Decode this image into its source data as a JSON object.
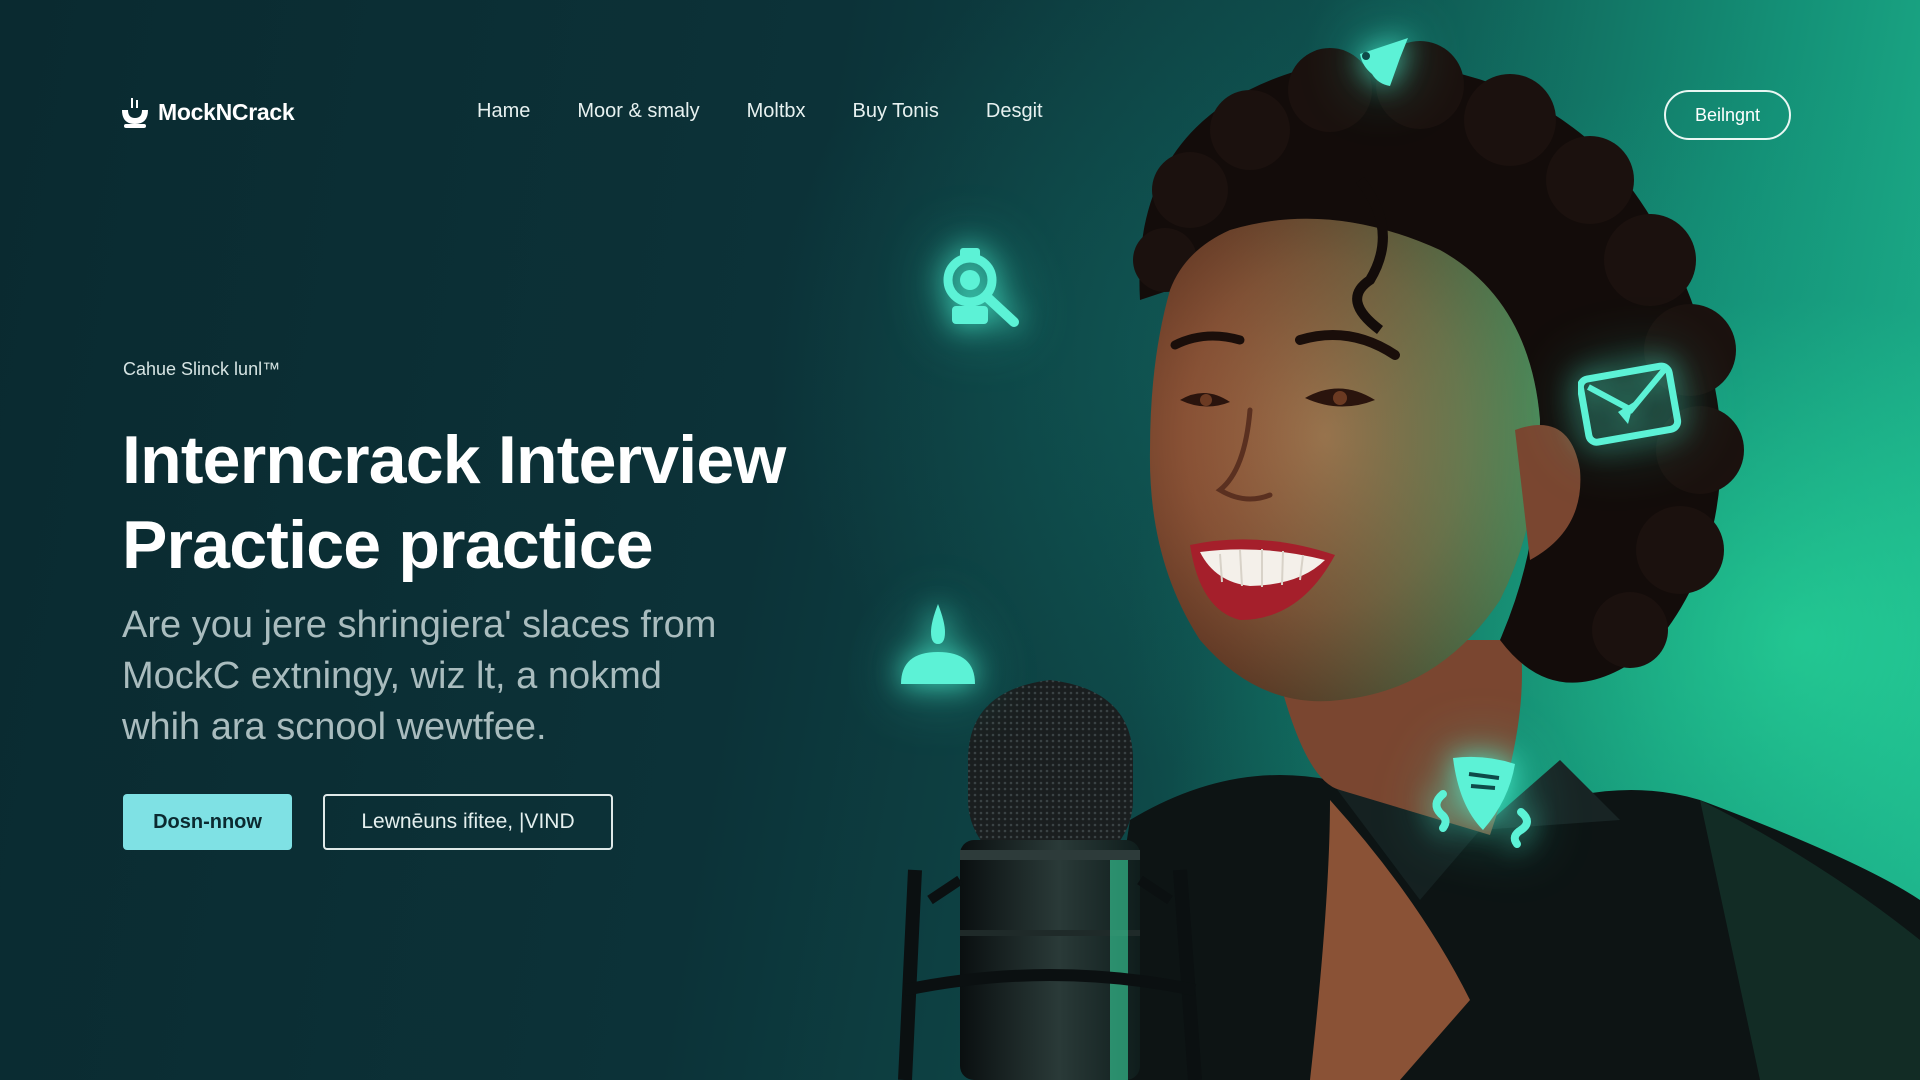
{
  "brand": {
    "name": "MockNCrack"
  },
  "nav": {
    "links": [
      "Hame",
      "Moor & smaly",
      "Moltbx",
      "Buy Tonis",
      "Desgit"
    ],
    "signin_label": "Beilngnt"
  },
  "hero": {
    "eyebrow": "Cahue Slinck lunl™",
    "headline_line1": "Interncrack Interview",
    "headline_line2": "Practice practice",
    "subtitle_line1": "Are you jere shringiera' slaces from",
    "subtitle_line2": "MockC extningy, wiz lt, a nokmd",
    "subtitle_line3": "whih ara scnool wewtfee.",
    "cta_primary": "Dosn-nnow",
    "cta_secondary": "Lewnēuns ifitee, |VIND"
  },
  "icons": {
    "logo": "microphone-logo-icon",
    "floating": [
      "pen-nib-icon",
      "magnifier-camera-icon",
      "envelope-icon",
      "speech-bubble-icon",
      "shield-arrows-icon"
    ]
  },
  "colors": {
    "background_dark": "#0b2a30",
    "accent_teal": "#1fb98f",
    "cta_primary_bg": "#7fe1e4",
    "icon_glow": "#5cf2d6"
  }
}
